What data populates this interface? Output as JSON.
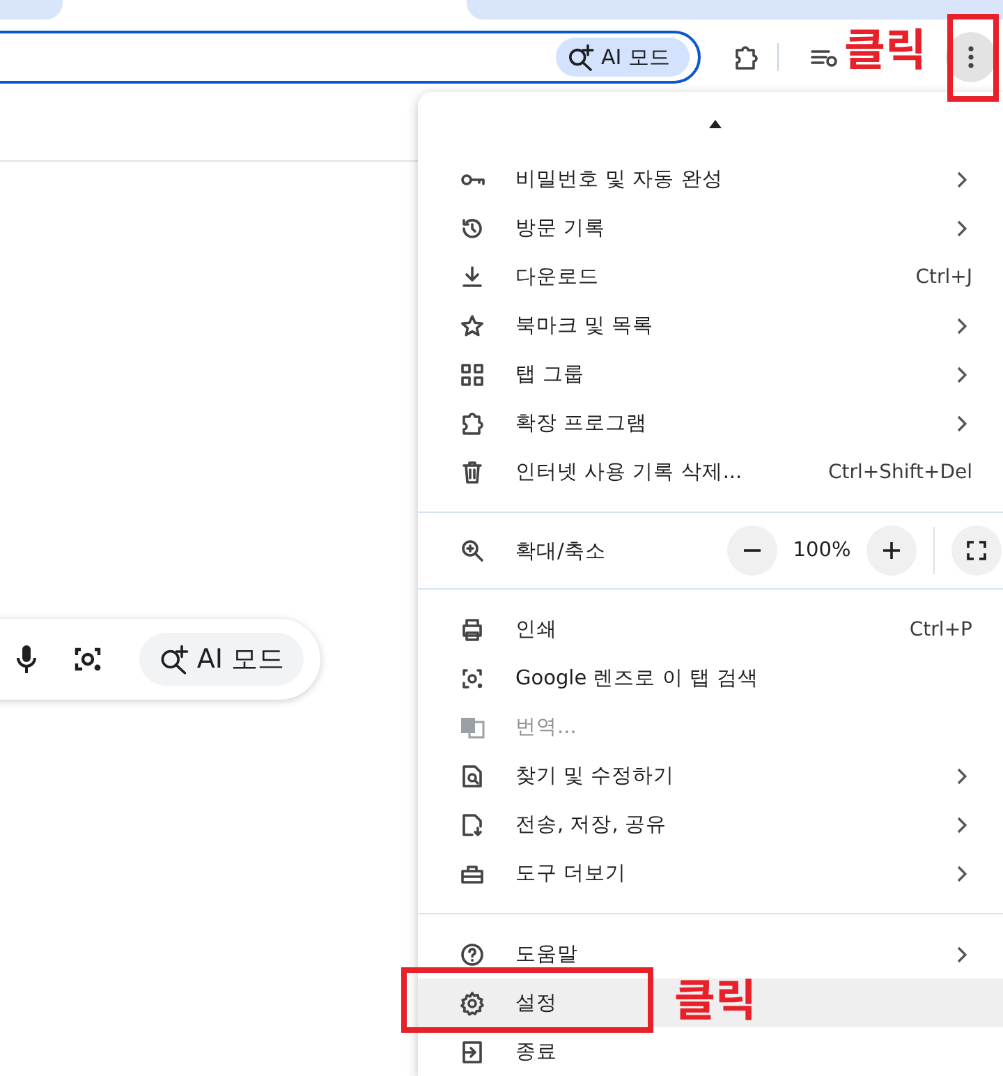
{
  "toolbar": {
    "omnibox": {
      "chip": "AI 모드"
    },
    "menu_button": {
      "active": true
    }
  },
  "search_box": {
    "chip": "AI 모드"
  },
  "menu": {
    "sections": [
      {
        "kind": "items",
        "items": [
          {
            "label": "비밀번호 및 자동 완성",
            "submenu": true,
            "disabled": false,
            "highlighted": false
          },
          {
            "label": "방문 기록",
            "submenu": true,
            "disabled": false,
            "highlighted": false
          },
          {
            "label": "다운로드",
            "shortcut": "Ctrl+J",
            "submenu": false,
            "disabled": false,
            "highlighted": false
          },
          {
            "label": "북마크 및 목록",
            "submenu": true,
            "disabled": false,
            "highlighted": false
          },
          {
            "label": "탭 그룹",
            "submenu": true,
            "disabled": false,
            "highlighted": false
          },
          {
            "label": "확장 프로그램",
            "submenu": true,
            "disabled": false,
            "highlighted": false
          },
          {
            "label": "인터넷 사용 기록 삭제...",
            "shortcut": "Ctrl+Shift+Del",
            "submenu": false,
            "disabled": false,
            "highlighted": false
          }
        ]
      },
      {
        "kind": "zoom",
        "label": "확대/축소",
        "value": "100%"
      },
      {
        "kind": "items",
        "items": [
          {
            "label": "인쇄",
            "shortcut": "Ctrl+P",
            "submenu": false,
            "disabled": false,
            "highlighted": false
          },
          {
            "label": "Google 렌즈로 이 탭 검색",
            "submenu": false,
            "disabled": false,
            "highlighted": false
          },
          {
            "label": "번역...",
            "submenu": false,
            "disabled": true,
            "highlighted": false
          },
          {
            "label": "찾기 및 수정하기",
            "submenu": true,
            "disabled": false,
            "highlighted": false
          },
          {
            "label": "전송, 저장, 공유",
            "submenu": true,
            "disabled": false,
            "highlighted": false
          },
          {
            "label": "도구 더보기",
            "submenu": true,
            "disabled": false,
            "highlighted": false
          }
        ]
      },
      {
        "kind": "items",
        "items": [
          {
            "label": "도움말",
            "submenu": true,
            "disabled": false,
            "highlighted": false
          },
          {
            "label": "설정",
            "submenu": false,
            "disabled": false,
            "highlighted": true
          },
          {
            "label": "종료",
            "submenu": false,
            "disabled": false,
            "highlighted": false
          }
        ]
      }
    ]
  },
  "annotations": [
    {
      "text": "클릭"
    },
    {
      "text": "클릭"
    }
  ]
}
